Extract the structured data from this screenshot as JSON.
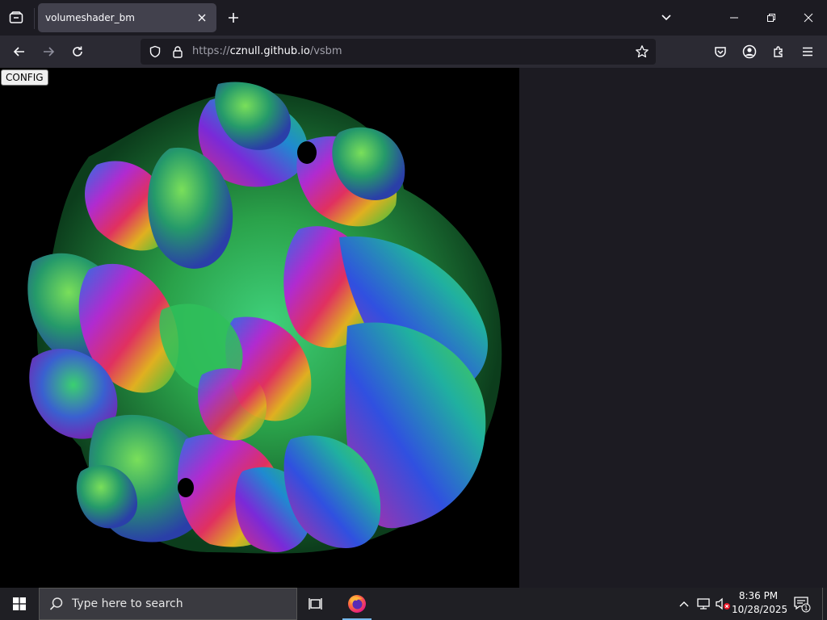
{
  "browser": {
    "tab": {
      "title": "volumeshader_bm",
      "active": true
    },
    "url": {
      "scheme": "https://",
      "host": "cznull.github.io",
      "path": "/vsbm"
    },
    "icons": {
      "list_all_tabs": "tab-list-icon",
      "new_tab": "plus-icon",
      "tabs_menu": "chevron-down-icon",
      "back": "arrow-left-icon",
      "forward": "arrow-right-icon",
      "reload": "reload-icon",
      "shield": "shield-icon",
      "lock": "lock-icon",
      "bookmark": "star-icon",
      "pocket": "pocket-icon",
      "account": "account-icon",
      "extensions": "puzzle-icon",
      "menu": "hamburger-icon"
    }
  },
  "page": {
    "config_button": "CONFIG",
    "canvas_desc": "volume shader fractal render"
  },
  "taskbar": {
    "search_placeholder": "Type here to search",
    "clock_time": "8:36 PM",
    "clock_date": "10/28/2025",
    "notifications_count": "1"
  },
  "colors": {
    "tab_active": "#42414d",
    "toolbar": "#2b2a33",
    "urlbar": "#1c1b22",
    "taskbar": "#1f1f24",
    "firefox_active": "#76b9ed"
  }
}
